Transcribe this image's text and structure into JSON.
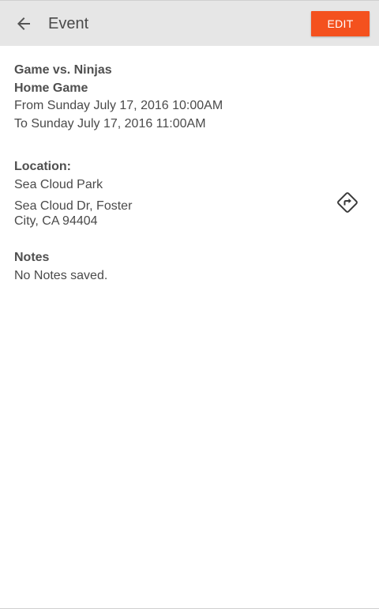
{
  "header": {
    "title": "Event",
    "edit_label": "EDIT",
    "back_icon": "arrow-left-icon"
  },
  "event": {
    "name": "Game vs. Ninjas",
    "type": "Home Game",
    "from": "From Sunday July 17, 2016 10:00AM",
    "to": "To Sunday July 17, 2016 11:00AM"
  },
  "location": {
    "label": "Location:",
    "name": "Sea Cloud Park",
    "address_line1": "Sea Cloud Dr, Foster",
    "address_line2": "City, CA 94404",
    "directions_icon": "directions-icon"
  },
  "notes": {
    "label": "Notes",
    "text": "No Notes saved."
  },
  "colors": {
    "accent": "#f4511e",
    "toolbar": "#e6e6e6",
    "text": "#4a4a4a"
  }
}
